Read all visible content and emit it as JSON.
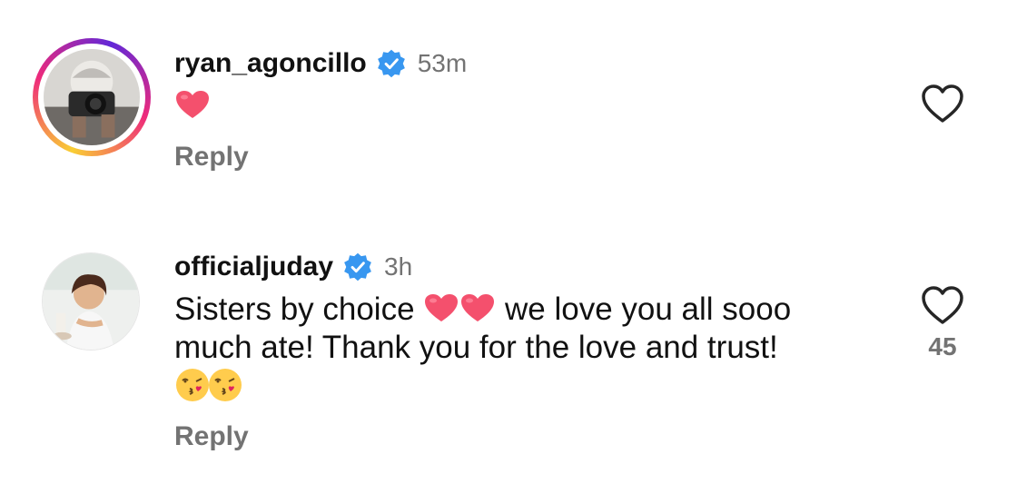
{
  "comments": [
    {
      "username": "ryan_agoncillo",
      "time": "53m",
      "text_parts": [
        "",
        "",
        ""
      ],
      "reply_label": "Reply",
      "like_count": ""
    },
    {
      "username": "officialjuday",
      "time": "3h",
      "text_parts": [
        "Sisters by choice ",
        " we love you all sooo much ate! Thank you for the love and trust!",
        ""
      ],
      "reply_label": "Reply",
      "like_count": "45"
    }
  ],
  "colors": {
    "verified": "#3897f0",
    "heart_emoji": "#f4506d",
    "secondary_text": "#737373"
  },
  "icons": [
    "verified-badge-icon",
    "heart-outline-icon",
    "red-heart-emoji",
    "kissing-face-emoji"
  ]
}
